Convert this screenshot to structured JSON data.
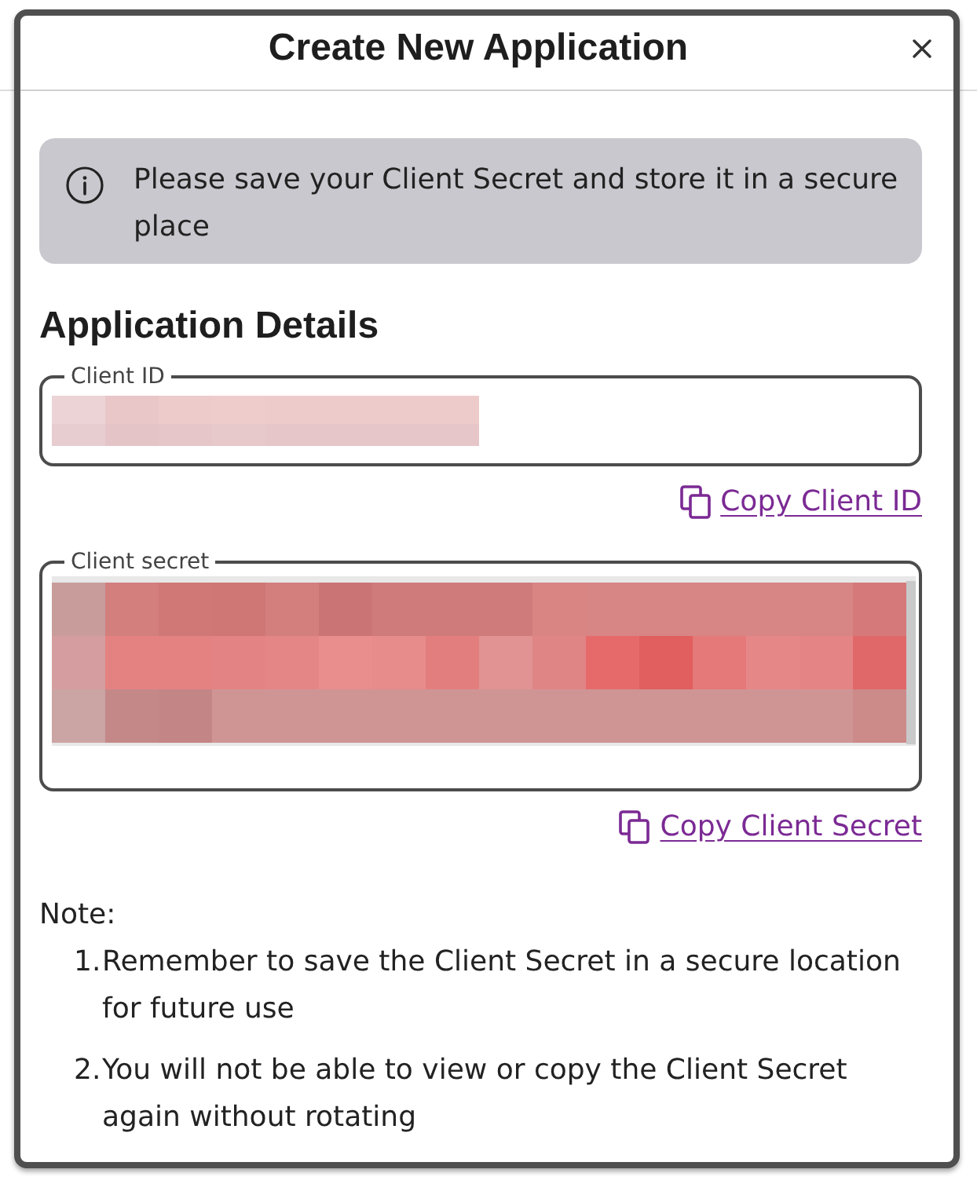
{
  "dialog": {
    "title": "Create New Application"
  },
  "alert": {
    "kind": "info",
    "message": "Please save your Client Secret and store it in a secure place"
  },
  "section": {
    "heading": "Application Details"
  },
  "fields": [
    {
      "kind": "single_line",
      "label": "Client ID",
      "redacted": true,
      "copy_link": "Copy Client ID"
    },
    {
      "kind": "multi_line",
      "label": "Client secret",
      "redacted": true,
      "copy_link": "Copy Client Secret"
    }
  ],
  "note": {
    "label": "Note:",
    "items": [
      {
        "marker": "1.",
        "text": "Remember to save the Client Secret in a secure location for future use"
      },
      {
        "marker": "2.",
        "text": "You will not be able to view or copy the Client Secret again without rotating"
      }
    ]
  }
}
